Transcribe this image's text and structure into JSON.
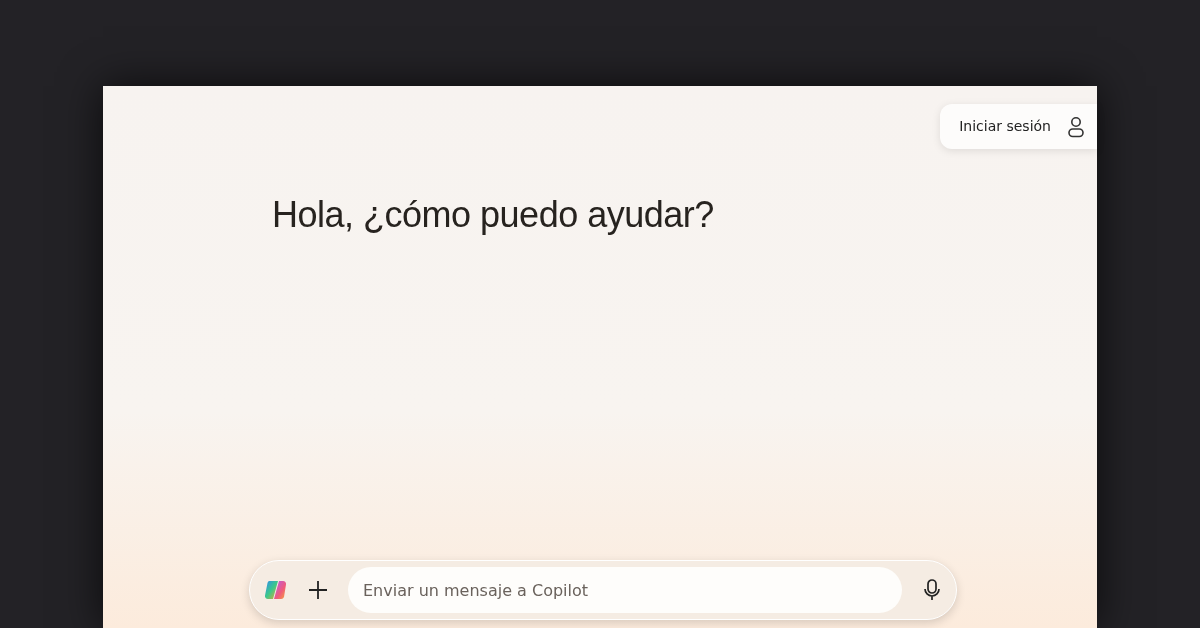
{
  "header": {
    "sign_in_label": "Iniciar sesión"
  },
  "greeting": "Hola, ¿cómo puedo ayudar?",
  "composer": {
    "placeholder": "Enviar un mensaje a Copilot"
  }
}
